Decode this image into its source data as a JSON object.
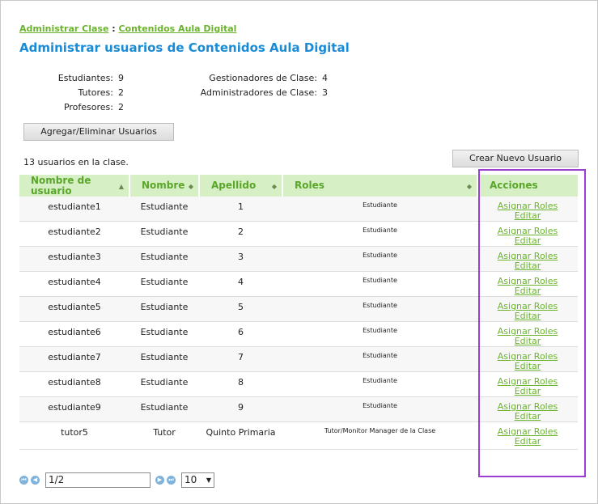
{
  "breadcrumb": {
    "item1": "Administrar Clase",
    "sep": " : ",
    "item2": "Contenidos Aula Digital"
  },
  "title": "Administrar usuarios de Contenidos Aula Digital",
  "stats": {
    "estudiantes_label": "Estudiantes:",
    "estudiantes": "9",
    "tutores_label": "Tutores:",
    "tutores": "2",
    "profesores_label": "Profesores:",
    "profesores": "2",
    "gestionadores_label": "Gestionadores de Clase:",
    "gestionadores": "4",
    "administradores_label": "Administradores de Clase:",
    "administradores": "3"
  },
  "buttons": {
    "add_remove": "Agregar/Eliminar Usuarios",
    "create_user": "Crear Nuevo Usuario"
  },
  "user_count": "13 usuarios en la clase.",
  "table": {
    "headers": {
      "username": "Nombre de usuario",
      "first": "Nombre",
      "last": "Apellido",
      "roles": "Roles",
      "actions": "Acciones"
    },
    "rows": [
      {
        "username": "estudiante1",
        "first": "Estudiante",
        "last": "1",
        "roles": "Estudiante"
      },
      {
        "username": "estudiante2",
        "first": "Estudiante",
        "last": "2",
        "roles": "Estudiante"
      },
      {
        "username": "estudiante3",
        "first": "Estudiante",
        "last": "3",
        "roles": "Estudiante"
      },
      {
        "username": "estudiante4",
        "first": "Estudiante",
        "last": "4",
        "roles": "Estudiante"
      },
      {
        "username": "estudiante5",
        "first": "Estudiante",
        "last": "5",
        "roles": "Estudiante"
      },
      {
        "username": "estudiante6",
        "first": "Estudiante",
        "last": "6",
        "roles": "Estudiante"
      },
      {
        "username": "estudiante7",
        "first": "Estudiante",
        "last": "7",
        "roles": "Estudiante"
      },
      {
        "username": "estudiante8",
        "first": "Estudiante",
        "last": "8",
        "roles": "Estudiante"
      },
      {
        "username": "estudiante9",
        "first": "Estudiante",
        "last": "9",
        "roles": "Estudiante"
      },
      {
        "username": "tutor5",
        "first": "Tutor",
        "last": "Quinto Primaria",
        "roles": "Tutor/Monitor  Manager de la Clase"
      }
    ],
    "action_assign": "Asignar Roles",
    "action_edit": "Editar"
  },
  "pager": {
    "page": "1/2",
    "page_size": "10"
  },
  "colors": {
    "accent_green": "#6ab42d",
    "title_blue": "#1a8bd6",
    "header_bg": "#d7efc4",
    "highlight": "#9a3fd1"
  }
}
